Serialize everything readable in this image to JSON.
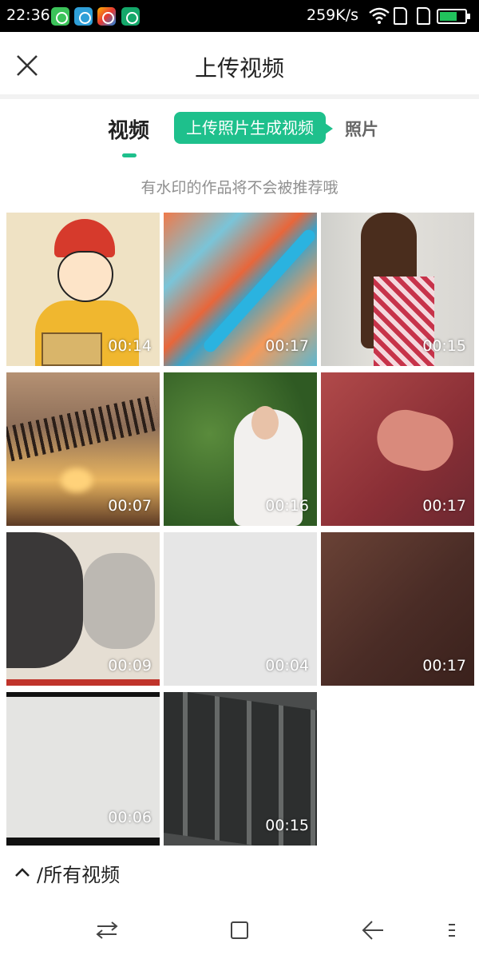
{
  "status_bar": {
    "time": "22:36",
    "network_speed": "259K/s",
    "battery_level": 0.7,
    "app_icons": [
      "wechat-like-icon",
      "browser-icon",
      "gallery-icon",
      "usb-icon"
    ]
  },
  "header": {
    "title": "上传视频",
    "close_icon": "close-icon"
  },
  "tabs": {
    "video_label": "视频",
    "promo_label": "上传照片生成视频",
    "photo_label": "照片",
    "accent_color": "#1ec08c"
  },
  "hint": "有水印的作品将不会被推荐哦",
  "videos": [
    {
      "duration": "00:14"
    },
    {
      "duration": "00:17"
    },
    {
      "duration": "00:15"
    },
    {
      "duration": "00:07"
    },
    {
      "duration": "00:16"
    },
    {
      "duration": "00:17"
    },
    {
      "duration": "00:09"
    },
    {
      "duration": "00:04"
    },
    {
      "duration": "00:17"
    },
    {
      "duration": "00:06"
    },
    {
      "duration": "00:15"
    }
  ],
  "album": {
    "label": "/所有视频",
    "icon": "chevron-up-icon"
  },
  "navbar": {
    "icons": [
      "switch-apps-icon",
      "home-icon",
      "back-icon",
      "menu-icon"
    ]
  }
}
